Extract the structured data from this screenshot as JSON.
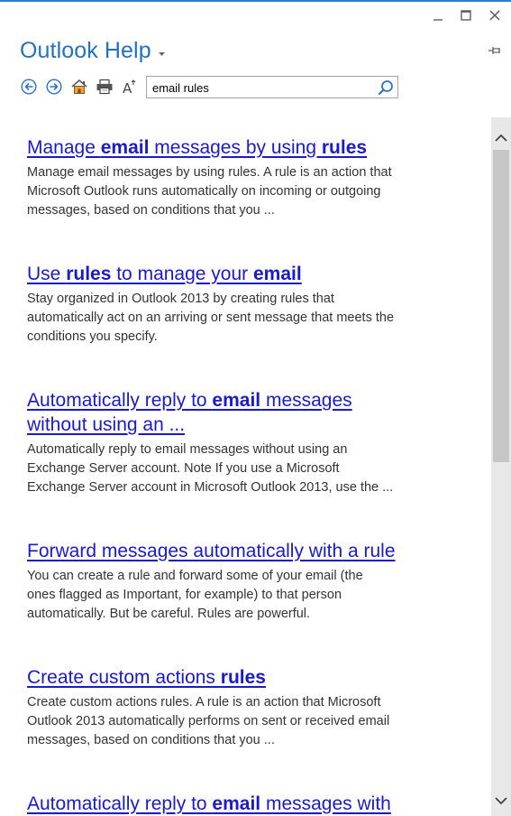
{
  "window": {
    "minimize_icon": "minimize-icon",
    "maximize_icon": "maximize-icon",
    "close_icon": "close-icon",
    "accent_color": "#2b7cd3"
  },
  "header": {
    "title": "Outlook Help",
    "title_color": "#2372ba",
    "pin_icon": "pin-icon"
  },
  "toolbar": {
    "back_icon": "back-arrow-icon",
    "forward_icon": "forward-arrow-icon",
    "home_icon": "home-icon",
    "print_icon": "print-icon",
    "font_size_icon": "font-size-icon"
  },
  "search": {
    "value": "email rules",
    "search_icon": "search-icon"
  },
  "results": [
    {
      "title_parts": [
        {
          "text": "Manage ",
          "bold": false
        },
        {
          "text": "email",
          "bold": true
        },
        {
          "text": " messages by using ",
          "bold": false
        },
        {
          "text": "rules",
          "bold": true
        }
      ],
      "description_lines": [
        "Manage email messages by using rules. A rule is an action that",
        "Microsoft Outlook runs automatically on incoming or outgoing",
        "messages, based on conditions that you ..."
      ]
    },
    {
      "title_parts": [
        {
          "text": "Use ",
          "bold": false
        },
        {
          "text": "rules",
          "bold": true
        },
        {
          "text": " to manage your ",
          "bold": false
        },
        {
          "text": "email",
          "bold": true
        }
      ],
      "description_lines": [
        "Stay organized in Outlook 2013 by creating rules that",
        "automatically act on an arriving or sent message that meets the",
        "conditions you specify."
      ]
    },
    {
      "title_lines": [
        [
          {
            "text": "Automatically reply to ",
            "bold": false
          },
          {
            "text": "email",
            "bold": true
          },
          {
            "text": " messages",
            "bold": false
          }
        ],
        [
          {
            "text": "without using an ...",
            "bold": false
          }
        ]
      ],
      "description_lines": [
        "Automatically reply to email messages without using an",
        "Exchange Server account. Note If you use a Microsoft",
        "Exchange Server account in Microsoft Outlook 2013, use the ..."
      ]
    },
    {
      "title_parts": [
        {
          "text": "Forward messages automatically with a rule",
          "bold": false
        }
      ],
      "description_lines": [
        "You can create a rule and forward some of your email (the",
        "ones flagged as Important, for example) to that person",
        "automatically. But be careful. Rules are powerful."
      ]
    },
    {
      "title_parts": [
        {
          "text": "Create custom actions ",
          "bold": false
        },
        {
          "text": "rules",
          "bold": true
        }
      ],
      "description_lines": [
        "Create custom actions rules. A rule is an action that Microsoft",
        "Outlook 2013 automatically performs on sent or received email",
        "messages, based on conditions that you ..."
      ]
    },
    {
      "title_parts": [
        {
          "text": "Automatically reply to ",
          "bold": false
        },
        {
          "text": "email",
          "bold": true
        },
        {
          "text": " messages with",
          "bold": false
        }
      ],
      "description_lines": []
    }
  ],
  "link_color": "#1a1acc",
  "scrollbar": {
    "up_icon": "chevron-up-icon",
    "down_icon": "chevron-down-icon",
    "position_fraction": 0.0
  }
}
